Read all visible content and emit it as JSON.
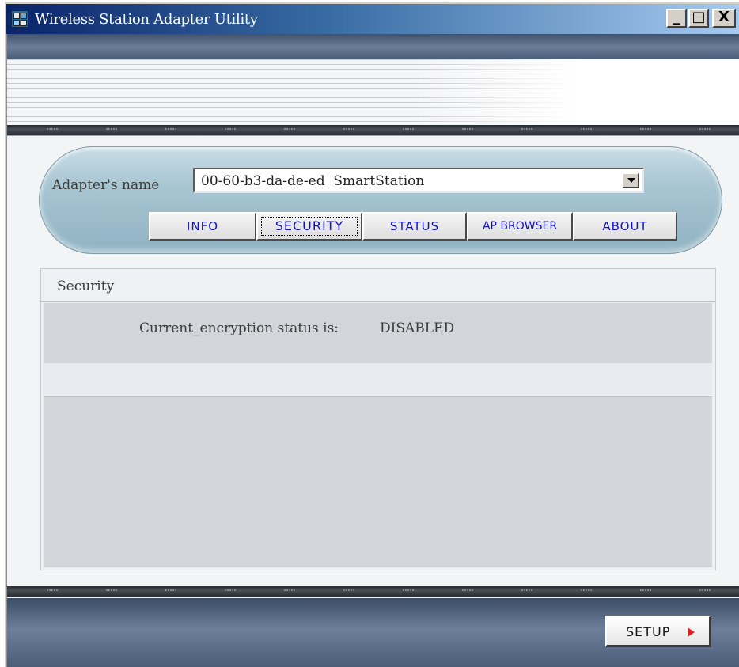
{
  "window": {
    "title": "Wireless Station Adapter Utility",
    "controls": {
      "minimize": "_",
      "maximize": "□",
      "close": "X"
    }
  },
  "adapter": {
    "label": "Adapter's name",
    "selected": "00-60-b3-da-de-ed  SmartStation"
  },
  "tabs": [
    {
      "label": "INFO",
      "active": false
    },
    {
      "label": "SECURITY",
      "active": true
    },
    {
      "label": "STATUS",
      "active": false
    },
    {
      "label": "AP BROWSER",
      "active": false
    },
    {
      "label": "ABOUT",
      "active": false
    }
  ],
  "security": {
    "title": "Security",
    "encryption_label": "Current_encryption status is:",
    "encryption_value": "DISABLED"
  },
  "footer": {
    "setup_label": "SETUP"
  },
  "colors": {
    "tab_text": "#1010c8",
    "setup_arrow": "#e02020",
    "panel_accent": "#a9c6d3"
  },
  "icons": [
    "app-icon",
    "dropdown-arrow-icon",
    "right-arrow-icon"
  ]
}
